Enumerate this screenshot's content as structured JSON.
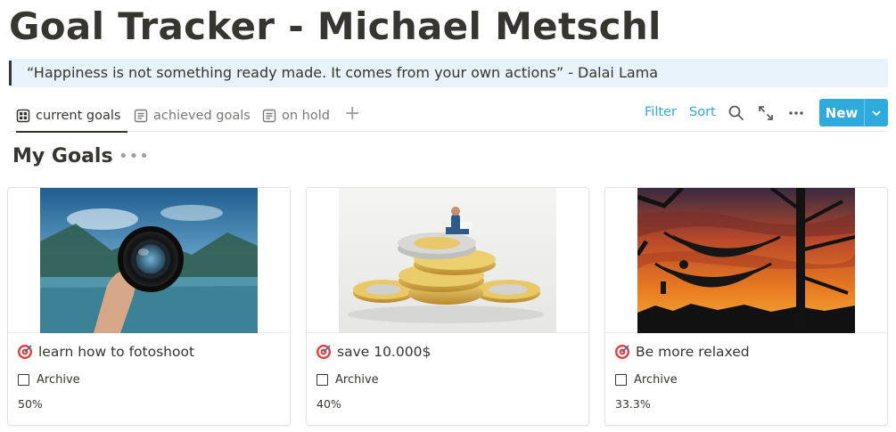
{
  "page": {
    "title": "Goal Tracker - Michael Metschl",
    "quote": "“Happiness is not something ready made. It comes from your own actions” - Dalai Lama"
  },
  "tabs": [
    {
      "label": "current goals",
      "icon": "gallery-icon",
      "active": true
    },
    {
      "label": "achieved goals",
      "icon": "list-page-icon",
      "active": false
    },
    {
      "label": "on hold",
      "icon": "list-page-icon",
      "active": false
    }
  ],
  "toolbar": {
    "add_tab_icon": "plus-icon",
    "filter_label": "Filter",
    "sort_label": "Sort",
    "search_icon": "search-icon",
    "expand_icon": "expand-icon",
    "more_icon": "more-icon",
    "new_label": "New",
    "new_chevron_icon": "chevron-down-icon",
    "accent_color": "#2eaadc"
  },
  "section": {
    "title": "My Goals",
    "more_icon": "more-icon"
  },
  "cards": [
    {
      "title": "learn how to fotoshoot",
      "icon": "target-icon",
      "checkbox_label": "Archive",
      "checked": false,
      "progress_text": "50%",
      "cover": "lens-lake-photo"
    },
    {
      "title": "save 10.000$",
      "icon": "target-icon",
      "checkbox_label": "Archive",
      "checked": false,
      "progress_text": "40%",
      "cover": "coin-stack-photo"
    },
    {
      "title": "Be more relaxed",
      "icon": "target-icon",
      "checkbox_label": "Archive",
      "checked": false,
      "progress_text": "33.3%",
      "cover": "hammock-sunset-photo"
    }
  ]
}
